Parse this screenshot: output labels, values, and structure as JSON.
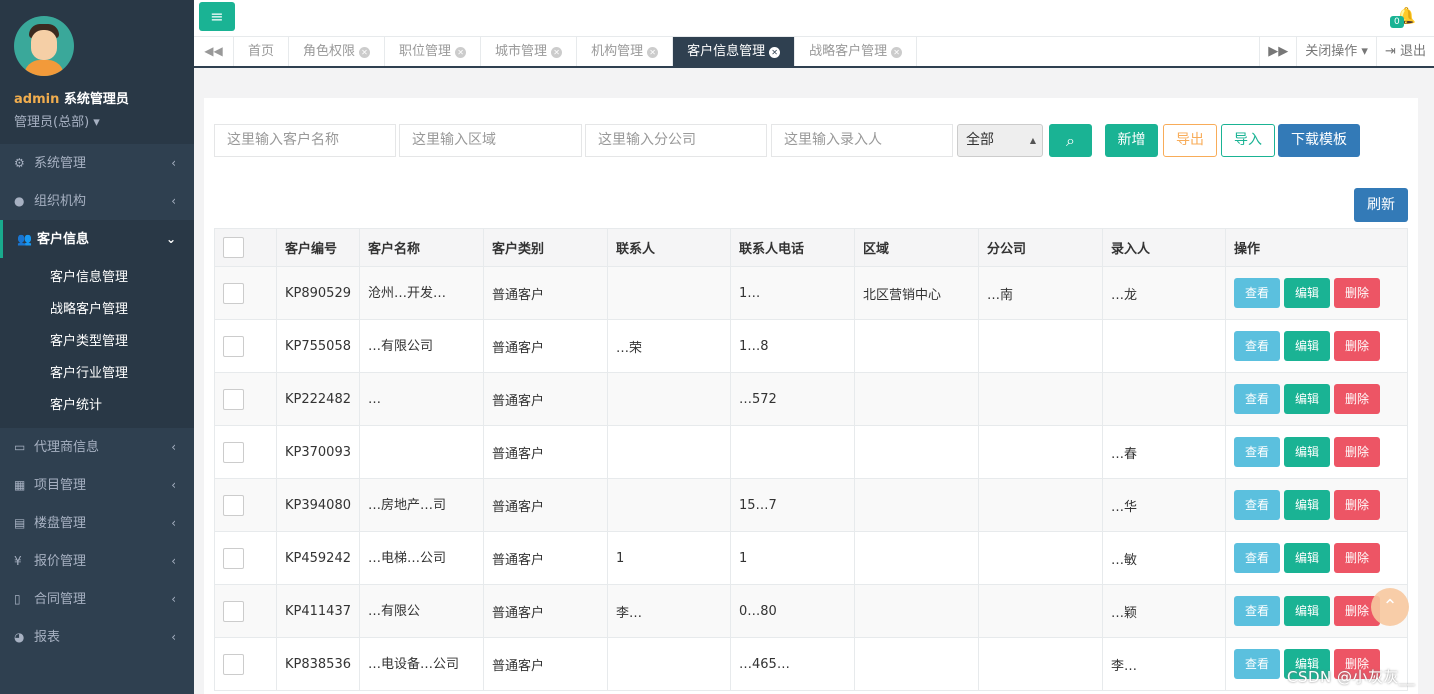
{
  "sidebar": {
    "user_name": "admin",
    "user_role": "系统管理员",
    "department": "管理员(总部)",
    "menu": [
      {
        "label": "系统管理",
        "icon": "gear-icon"
      },
      {
        "label": "组织机构",
        "icon": "user-icon"
      },
      {
        "label": "客户信息",
        "icon": "users-icon"
      },
      {
        "label": "代理商信息",
        "icon": "cars-icon"
      },
      {
        "label": "项目管理",
        "icon": "grid-icon"
      },
      {
        "label": "楼盘管理",
        "icon": "building-icon"
      },
      {
        "label": "报价管理",
        "icon": "yen-icon"
      },
      {
        "label": "合同管理",
        "icon": "file-icon"
      },
      {
        "label": "报表",
        "icon": "pie-icon"
      }
    ],
    "submenu": [
      "客户信息管理",
      "战略客户管理",
      "客户类型管理",
      "客户行业管理",
      "客户统计"
    ]
  },
  "header": {
    "bell_count": "0"
  },
  "tabs": {
    "items": [
      "首页",
      "角色权限",
      "职位管理",
      "城市管理",
      "机构管理",
      "客户信息管理",
      "战略客户管理"
    ],
    "active": "客户信息管理",
    "close_ops": "关闭操作",
    "logout": "退出"
  },
  "search": {
    "name_placeholder": "这里输入客户名称",
    "area_placeholder": "这里输入区域",
    "branch_placeholder": "这里输入分公司",
    "entry_placeholder": "这里输入录入人",
    "select_value": "全部",
    "add": "新增",
    "export": "导出",
    "import": "导入",
    "template": "下载模板",
    "refresh": "刷新"
  },
  "table": {
    "headers": [
      "客户编号",
      "客户名称",
      "客户类别",
      "联系人",
      "联系人电话",
      "区域",
      "分公司",
      "录入人",
      "操作"
    ],
    "rows": [
      {
        "id": "KP890529",
        "name": "沧州…开发…",
        "type": "普通客户",
        "contact": "",
        "phone": "1…",
        "area": "北区营销中心",
        "branch": "…南",
        "entry": "…龙"
      },
      {
        "id": "KP755058",
        "name": "…有限公司",
        "type": "普通客户",
        "contact": "…荣",
        "phone": "1…8",
        "area": "",
        "branch": "",
        "entry": ""
      },
      {
        "id": "KP222482",
        "name": "…",
        "type": "普通客户",
        "contact": "",
        "phone": "…572",
        "area": "",
        "branch": "",
        "entry": ""
      },
      {
        "id": "KP370093",
        "name": "",
        "type": "普通客户",
        "contact": "",
        "phone": "",
        "area": "",
        "branch": "",
        "entry": "…春"
      },
      {
        "id": "KP394080",
        "name": "…房地产…司",
        "type": "普通客户",
        "contact": "",
        "phone": "15…7",
        "area": "",
        "branch": "",
        "entry": "…华"
      },
      {
        "id": "KP459242",
        "name": "…电梯…公司",
        "type": "普通客户",
        "contact": "1",
        "phone": "1",
        "area": "",
        "branch": "",
        "entry": "…敏"
      },
      {
        "id": "KP411437",
        "name": "…有限公",
        "type": "普通客户",
        "contact": "李…",
        "phone": "0…80",
        "area": "",
        "branch": "",
        "entry": "…颖"
      },
      {
        "id": "KP838536",
        "name": "…电设备…公司",
        "type": "普通客户",
        "contact": "",
        "phone": "…465…",
        "area": "",
        "branch": "",
        "entry": "李…"
      }
    ],
    "ops": {
      "view": "查看",
      "edit": "编辑",
      "delete": "删除"
    }
  },
  "watermark": "CSDN @小灰灰__"
}
